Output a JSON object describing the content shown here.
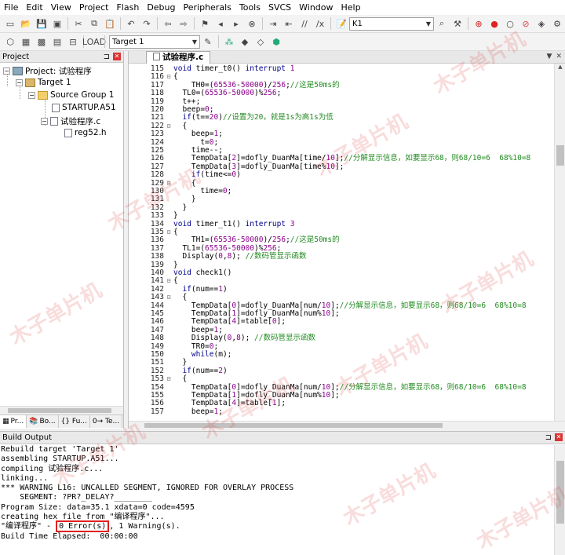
{
  "menubar": {
    "items": [
      "File",
      "Edit",
      "View",
      "Project",
      "Flash",
      "Debug",
      "Peripherals",
      "Tools",
      "SVCS",
      "Window",
      "Help"
    ]
  },
  "toolbar1": {
    "search_value": "K1"
  },
  "toolbar2": {
    "target_select": "Target 1"
  },
  "project": {
    "title": "Project",
    "root": "Project: 试验程序",
    "target": "Target 1",
    "group": "Source Group 1",
    "files": [
      "STARTUP.A51",
      "试验程序.c"
    ],
    "include": "reg52.h",
    "tabs": [
      "Pr...",
      "Bo...",
      "{} Fu...",
      "0→ Te..."
    ]
  },
  "editor": {
    "tab_title": "试验程序.c",
    "lines": [
      {
        "n": "115",
        "f": "",
        "t": "void timer_t0() interrupt 1"
      },
      {
        "n": "116",
        "f": "⊟",
        "t": "{"
      },
      {
        "n": "117",
        "f": "",
        "t": "    TH0=(65536-50000)/256;//这是50ms的"
      },
      {
        "n": "118",
        "f": "",
        "t": "  TL0=(65536-50000)%256;"
      },
      {
        "n": "119",
        "f": "",
        "t": "  t++;"
      },
      {
        "n": "120",
        "f": "",
        "t": "  beep=0;"
      },
      {
        "n": "121",
        "f": "",
        "t": "  if(t==20)//设置为20，就是1s为高1s为低"
      },
      {
        "n": "122",
        "f": "⊟",
        "t": "  {"
      },
      {
        "n": "123",
        "f": "",
        "t": "    beep=1;"
      },
      {
        "n": "124",
        "f": "",
        "t": "      t=0;"
      },
      {
        "n": "125",
        "f": "",
        "t": "    time--;"
      },
      {
        "n": "126",
        "f": "",
        "t": "    TempData[2]=dofly_DuanMa[time/10];//分解显示信息，如要显示68，则68/10=6  68%10=8"
      },
      {
        "n": "127",
        "f": "",
        "t": "    TempData[3]=dofly_DuanMa[time%10];"
      },
      {
        "n": "128",
        "f": "",
        "t": "    if(time<=0)"
      },
      {
        "n": "129",
        "f": "⊟",
        "t": "    {"
      },
      {
        "n": "130",
        "f": "",
        "t": "      time=0;"
      },
      {
        "n": "131",
        "f": "",
        "t": "    }"
      },
      {
        "n": "132",
        "f": "",
        "t": "  }"
      },
      {
        "n": "133",
        "f": "",
        "t": "}"
      },
      {
        "n": "134",
        "f": "",
        "t": "void timer_t1() interrupt 3"
      },
      {
        "n": "135",
        "f": "⊟",
        "t": "{"
      },
      {
        "n": "136",
        "f": "",
        "t": "    TH1=(65536-50000)/256;//这是50ms的"
      },
      {
        "n": "137",
        "f": "",
        "t": "  TL1=(65536-50000)%256;"
      },
      {
        "n": "138",
        "f": "",
        "t": "  Display(0,8); //数码管显示函数"
      },
      {
        "n": "139",
        "f": "",
        "t": "}"
      },
      {
        "n": "140",
        "f": "",
        "t": "void check1()"
      },
      {
        "n": "141",
        "f": "⊟",
        "t": "{"
      },
      {
        "n": "142",
        "f": "",
        "t": "  if(num==1)"
      },
      {
        "n": "143",
        "f": "⊟",
        "t": "  {"
      },
      {
        "n": "144",
        "f": "",
        "t": "    TempData[0]=dofly_DuanMa[num/10];//分解显示信息，如要显示68，则68/10=6  68%10=8"
      },
      {
        "n": "145",
        "f": "",
        "t": "    TempData[1]=dofly_DuanMa[num%10];"
      },
      {
        "n": "146",
        "f": "",
        "t": "    TempData[4]=table[0];"
      },
      {
        "n": "147",
        "f": "",
        "t": "    beep=1;"
      },
      {
        "n": "148",
        "f": "",
        "t": "    Display(0,8); //数码管显示函数"
      },
      {
        "n": "149",
        "f": "",
        "t": "    TR0=0;"
      },
      {
        "n": "150",
        "f": "",
        "t": "    while(m);"
      },
      {
        "n": "151",
        "f": "",
        "t": "  }"
      },
      {
        "n": "152",
        "f": "",
        "t": "  if(num==2)"
      },
      {
        "n": "153",
        "f": "⊟",
        "t": "  {"
      },
      {
        "n": "154",
        "f": "",
        "t": "    TempData[0]=dofly_DuanMa[num/10];//分解显示信息，如要显示68，则68/10=6  68%10=8"
      },
      {
        "n": "155",
        "f": "",
        "t": "    TempData[1]=dofly_DuanMa[num%10];"
      },
      {
        "n": "156",
        "f": "",
        "t": "    TempData[4]=table[1];"
      },
      {
        "n": "157",
        "f": "",
        "t": "    beep=1;"
      }
    ]
  },
  "build": {
    "title": "Build Output",
    "lines": [
      "Rebuild target 'Target 1'",
      "assembling STARTUP.A51...",
      "compiling 试验程序.c...",
      "linking...",
      "*** WARNING L16: UNCALLED SEGMENT, IGNORED FOR OVERLAY PROCESS",
      "    SEGMENT: ?PR?_DELAY?________",
      "Program Size: data=35.1 xdata=0 code=4595",
      "creating hex file from \"编译程序\"..."
    ],
    "result_prefix": "\"编译程序\" - ",
    "result_errors": "0 Error(s)",
    "result_suffix": ", 1 Warning(s).",
    "elapsed": "Build Time Elapsed:  00:00:00"
  },
  "watermark": "木子单片机",
  "colors": {
    "keyword": "#00008b",
    "number": "#8b008b",
    "comment": "#228b22",
    "error_box": "#e02020"
  }
}
